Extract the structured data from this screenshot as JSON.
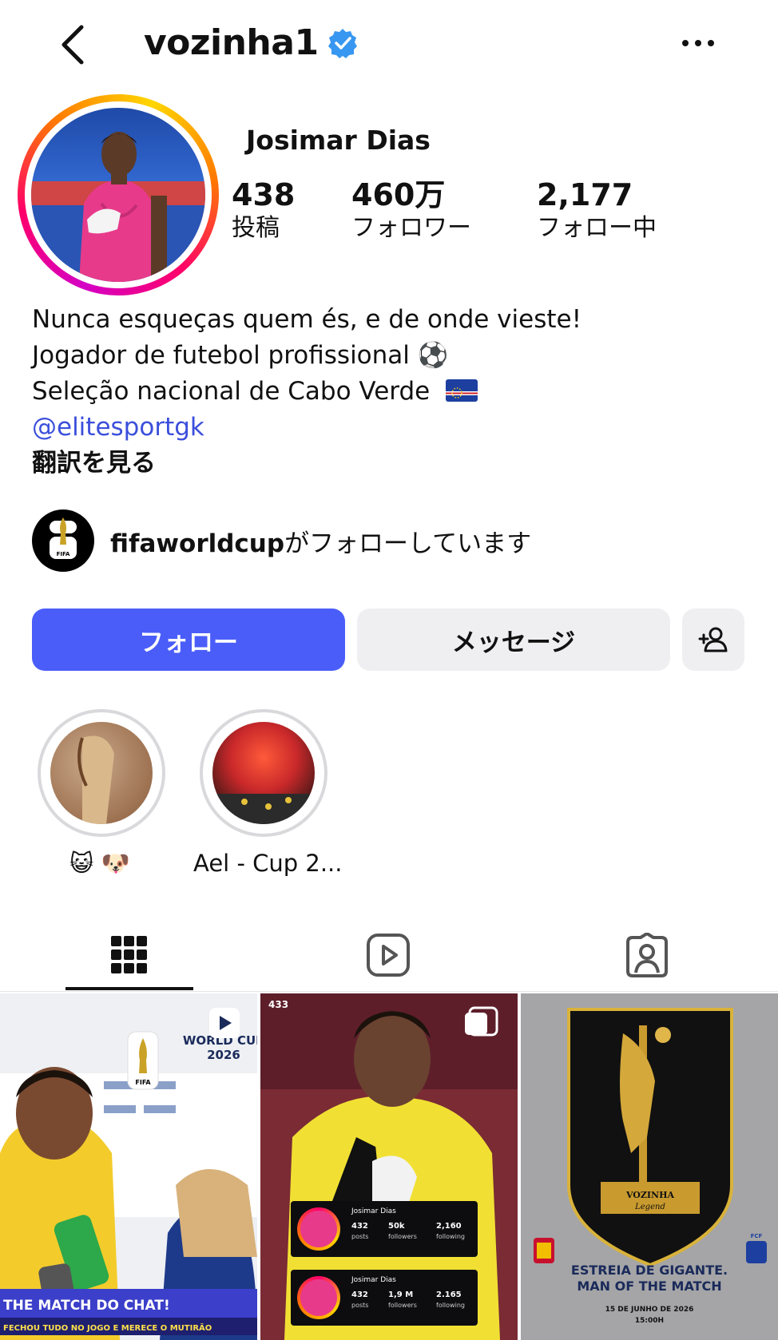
{
  "header": {
    "username": "vozinha1",
    "verified": true,
    "icons": {
      "back": "chevron-left-icon",
      "verified": "verified-badge-icon",
      "more": "more-horizontal-icon"
    }
  },
  "profile": {
    "display_name": "Josimar Dias",
    "stats": [
      {
        "value": "438",
        "label": "投稿"
      },
      {
        "value": "460万",
        "label": "フォロワー"
      },
      {
        "value": "2,177",
        "label": "フォロー中"
      }
    ]
  },
  "bio": {
    "line1": "Nunca esqueças quem és, e de onde vieste!",
    "line2": "Jogador de futebol profissional ⚽",
    "line3": "Seleção nacional de Cabo Verde",
    "mention": "@elitesportgk",
    "translate": "翻訳を見る"
  },
  "followed_by": {
    "account": "fifaworldcup",
    "suffix": "がフォローしています",
    "logo_text": "FIFA"
  },
  "actions": {
    "follow": "フォロー",
    "message": "メッセージ",
    "add_user_icon": "add-user-icon"
  },
  "highlights": [
    {
      "label": "😺 🐶"
    },
    {
      "label": "Ael - Cup 2..."
    }
  ],
  "tabs": [
    {
      "icon": "grid-icon",
      "active": true
    },
    {
      "icon": "reels-icon",
      "active": false
    },
    {
      "icon": "tagged-icon",
      "active": false
    }
  ],
  "posts": [
    {
      "badge": "WORLD CUP",
      "badge_year": "2026",
      "caption_top": "THE MATCH DO CHAT!",
      "caption_bottom": "FECHOU TUDO NO JOGO E MERECE O MUTIRÃO",
      "brand": "FIFA"
    },
    {
      "tag": "433",
      "cards": [
        {
          "name": "Josimar Dias",
          "posts": "432",
          "posts_label": "posts",
          "followers": "50k",
          "followers_label": "followers",
          "following": "2,160",
          "following_label": "following"
        },
        {
          "name": "Josimar Dias",
          "posts": "432",
          "posts_label": "posts",
          "followers": "1,9 M",
          "followers_label": "followers",
          "following": "2.165",
          "following_label": "following"
        }
      ]
    },
    {
      "logo_line1": "VOZINHA",
      "logo_line2": "Legend",
      "headline1": "ESTREIA DE GIGANTE.",
      "headline2": "MAN OF THE MATCH",
      "date": "15 DE JUNHO DE 2026",
      "time": "15:00H",
      "side_label": "FCF"
    }
  ],
  "colors": {
    "follow_button": "#4a5df9",
    "mention": "#3b4fdb",
    "secondary_button": "#efeff1",
    "verified_badge": "#3897f0"
  }
}
